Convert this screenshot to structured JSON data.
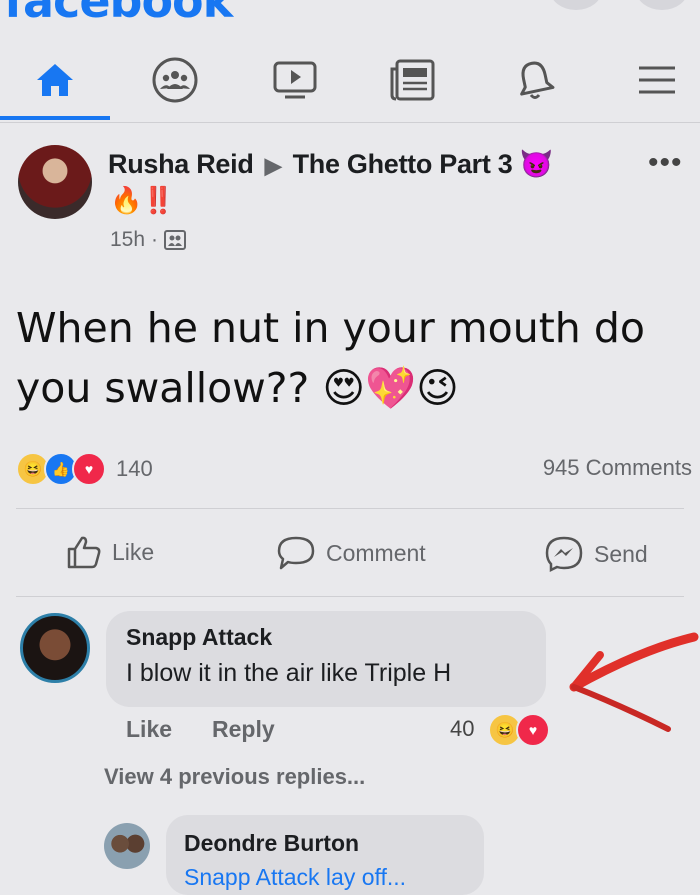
{
  "app": {
    "brand": "facebook"
  },
  "colors": {
    "accent": "#1877f2",
    "text": "#1c1e21",
    "muted": "#65676b",
    "annotation_arrow": "#e0302a"
  },
  "nav": {
    "items": [
      {
        "name": "home",
        "icon": "home-icon",
        "active": true
      },
      {
        "name": "groups",
        "icon": "groups-icon",
        "active": false
      },
      {
        "name": "watch",
        "icon": "watch-icon",
        "active": false
      },
      {
        "name": "news",
        "icon": "news-icon",
        "active": false
      },
      {
        "name": "notifications",
        "icon": "bell-icon",
        "active": false
      },
      {
        "name": "menu",
        "icon": "menu-icon",
        "active": false
      }
    ]
  },
  "post": {
    "author": "Rusha Reid",
    "group": "The Ghetto Part 3",
    "title_emoji": "😈",
    "title_emoji_line": "🔥‼️",
    "time": "15h",
    "audience_separator": "·",
    "text": "When he nut in your mouth do you swallow?? 😍💖😉",
    "reactions": {
      "count": "140",
      "types": [
        "haha",
        "like",
        "love"
      ]
    },
    "comments_count": "945 Comments",
    "more_label": "•••"
  },
  "actions": {
    "like": "Like",
    "comment": "Comment",
    "send": "Send"
  },
  "comment": {
    "author": "Snapp Attack",
    "text": "I blow it in the air like Triple H",
    "like": "Like",
    "reply": "Reply",
    "reaction_count": "40",
    "view_previous": "View 4 previous replies..."
  },
  "reply": {
    "author": "Deondre Burton",
    "text": "Snapp Attack lay off..."
  }
}
